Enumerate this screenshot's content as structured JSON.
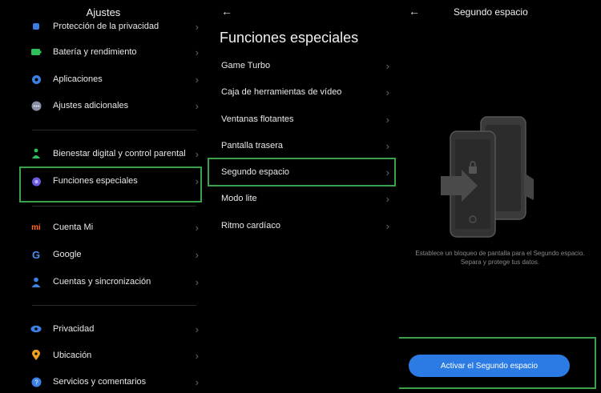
{
  "ajustes": {
    "title": "Ajustes",
    "items": [
      {
        "label": "Protección de la privacidad",
        "icon": "privacy-icon"
      },
      {
        "label": "Batería y rendimiento",
        "icon": "battery-icon"
      },
      {
        "label": "Aplicaciones",
        "icon": "gear-icon"
      },
      {
        "label": "Ajustes adicionales",
        "icon": "more-icon"
      },
      {
        "label": "Bienestar digital y control parental",
        "icon": "wellbeing-icon"
      },
      {
        "label": "Funciones especiales",
        "icon": "special-features-icon"
      },
      {
        "label": "Cuenta Mi",
        "icon": "mi-icon"
      },
      {
        "label": "Google",
        "icon": "google-icon"
      },
      {
        "label": "Cuentas y sincronización",
        "icon": "account-icon"
      },
      {
        "label": "Privacidad",
        "icon": "eye-icon"
      },
      {
        "label": "Ubicación",
        "icon": "location-icon"
      },
      {
        "label": "Servicios y comentarios",
        "icon": "help-icon"
      }
    ]
  },
  "funciones": {
    "title": "Funciones especiales",
    "items": [
      {
        "label": "Game Turbo"
      },
      {
        "label": "Caja de herramientas de vídeo"
      },
      {
        "label": "Ventanas flotantes"
      },
      {
        "label": "Pantalla trasera"
      },
      {
        "label": "Segundo espacio"
      },
      {
        "label": "Modo lite"
      },
      {
        "label": "Ritmo cardíaco"
      }
    ]
  },
  "segundo": {
    "title": "Segundo espacio",
    "description_line1": "Establece un bloqueo de pantalla para el Segundo espacio.",
    "description_line2": "Separa y protege tus datos.",
    "button_label": "Activar el Segundo espacio"
  },
  "colors": {
    "highlight": "#3aa04a",
    "button": "#2c7be5"
  }
}
